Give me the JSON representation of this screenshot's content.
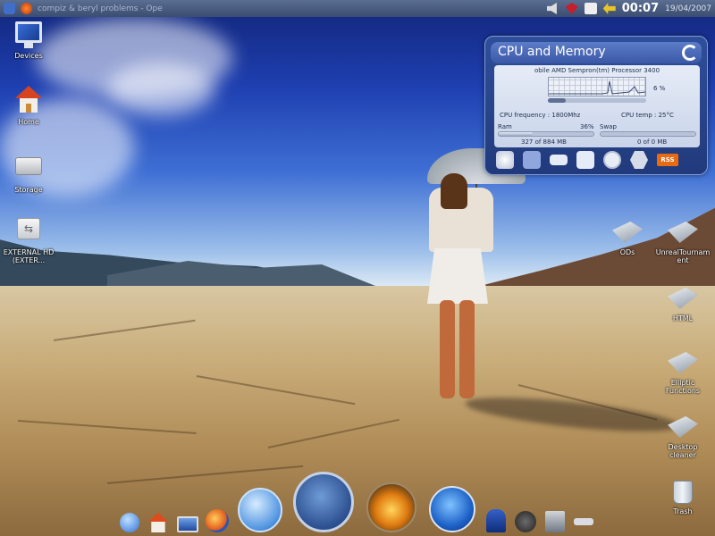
{
  "top_panel": {
    "window_title": "compiz & beryl problems - Ope",
    "clock": "00:07",
    "date": "19/04/2007"
  },
  "desktop_left": [
    {
      "label": "Devices",
      "icon": "monitor-icon"
    },
    {
      "label": "Home",
      "icon": "home-icon"
    },
    {
      "label": "Storage",
      "icon": "drive-icon"
    },
    {
      "label": "EXTERNAL HD (EXTER...",
      "icon": "usb-drive-icon"
    }
  ],
  "desktop_right": [
    {
      "label": "ODs",
      "icon": "folder-icon"
    },
    {
      "label": "UnrealTournament",
      "icon": "folder-icon"
    },
    {
      "label": "HTML",
      "icon": "folder-icon"
    },
    {
      "label": "Elliptic Functions",
      "icon": "folder-icon"
    },
    {
      "label": "Desktop cleaner",
      "icon": "folder-icon"
    },
    {
      "label": "Trash",
      "icon": "trash-icon"
    }
  ],
  "widget": {
    "title": "CPU and Memory",
    "processor": "obile AMD Sempron(tm) Processor 3400",
    "cpu_percent": "6 %",
    "cpu_load_fraction": 0.06,
    "cpu_frequency": "CPU frequency : 1800Mhz",
    "cpu_temp": "CPU temp : 25°C",
    "ram_label": "Ram",
    "ram_percent": "36%",
    "ram_fraction": 0.36,
    "ram_value": "327 of 884 MB",
    "swap_label": "Swap",
    "swap_fraction": 0.0,
    "swap_value": "0 of 0 MB",
    "tools": [
      "apple-icon",
      "cpu-icon",
      "drive-icon",
      "network-icon",
      "clock-icon",
      "gear-icon",
      "rss-icon"
    ],
    "rss_label": "RSS"
  },
  "dock": [
    "finder-icon",
    "home-icon",
    "desktop-icon",
    "firefox-icon",
    "mail-icon",
    "wolf-icon",
    "ubuntu-icon",
    "google-earth-icon",
    "gimp-icon",
    "paw-icon",
    "counter-strike-icon",
    "terminal-icon"
  ]
}
